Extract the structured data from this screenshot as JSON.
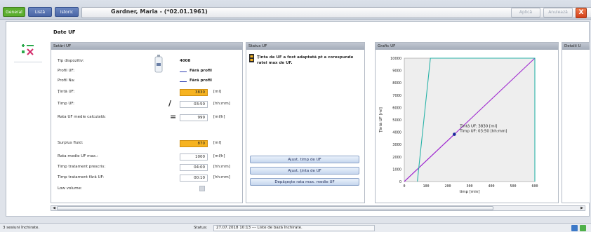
{
  "tabs": [
    {
      "label": "General"
    },
    {
      "label": "Listă"
    },
    {
      "label": "Istoric"
    }
  ],
  "patient": {
    "name": "Gardner, Maria - (*02.01.1961)"
  },
  "top_buttons": {
    "apply": "Aplică",
    "cancel": "Anulează",
    "close": "X"
  },
  "page": {
    "title": "Date UF"
  },
  "panels": {
    "settings": "Setări UF",
    "status": "Status UF",
    "graph": "Grafic UF",
    "details": "Detalii U"
  },
  "settings": {
    "device_type_label": "Tip dispozitiv:",
    "device_type_value": "4008",
    "uf_profile_label": "Profil UF:",
    "uf_profile_value": "Fără profil",
    "na_profile_label": "Profil Na:",
    "na_profile_value": "Fără profil",
    "uf_target_label": "Ţintă UF:",
    "uf_target_value": "3830",
    "uf_target_unit": "[ml]",
    "uf_time_label": "Timp UF:",
    "uf_time_value": "03:50",
    "uf_time_unit": "[hh:mm]",
    "calc_rate_label": "Rata UF medie calculată:",
    "calc_rate_value": "999",
    "calc_rate_unit": "[ml/h]",
    "surplus_label": "Surplus fluid:",
    "surplus_value": "870",
    "surplus_unit": "[ml]",
    "max_rate_label": "Rata medie UF max.:",
    "max_rate_value": "1000",
    "max_rate_unit": "[ml/h]",
    "prescribed_label": "Timp tratament prescris:",
    "prescribed_value": "04:00",
    "prescribed_unit": "[hh:mm]",
    "nouf_label": "Timp tratament fără UF:",
    "nouf_value": "00:10",
    "nouf_unit": "[hh:mm]",
    "lowvol_label": "Low volume:"
  },
  "status": {
    "message": "Ţinta de UF a fost adaptată pt a corespunde ratei max de UF.",
    "btn_time": "Ajust. timp de UF",
    "btn_target": "Ajust. ţinta de UF",
    "btn_exceed": "Depăşeşte rata max. medie UF"
  },
  "statusbar": {
    "left": "3 sesiuni închirate.",
    "status_label": "Status:",
    "status_value": "27.07.2018 10:13 --- Liste de bază închirate."
  },
  "chart_data": {
    "type": "line",
    "xlabel": "timp [min]",
    "ylabel": "Ţintă UF [ml]",
    "xlim": [
      0,
      600
    ],
    "ylim": [
      0,
      10000
    ],
    "xticks": [
      "0",
      "100",
      "200",
      "300",
      "400",
      "500",
      "600"
    ],
    "yticks": [
      "0",
      "1000",
      "2000",
      "3000",
      "4000",
      "5000",
      "6000",
      "7000",
      "8000",
      "9000",
      "10000"
    ],
    "series": [
      {
        "values": [
          [
            0,
            0
          ],
          [
            230,
            3830
          ]
        ],
        "color": "#a02bd0"
      },
      {
        "values": [
          [
            0,
            0
          ],
          [
            230,
            3830
          ],
          [
            600,
            10000
          ]
        ],
        "color": "#a02bd0"
      },
      {
        "values": [
          [
            60,
            0
          ],
          [
            120,
            10000
          ],
          [
            600,
            10000
          ],
          [
            600,
            0
          ]
        ],
        "color": "#29b3a8"
      }
    ],
    "marker": {
      "x": 230,
      "y": 3830
    },
    "annotation_line1": "Ţintă UF: 3830 [ml]",
    "annotation_line2": "Timp UF: 03:50 [hh:mm]"
  },
  "colors": {
    "accent_orange": "#f6b321",
    "line_purple": "#a02bd0",
    "line_teal": "#29b3a8"
  }
}
